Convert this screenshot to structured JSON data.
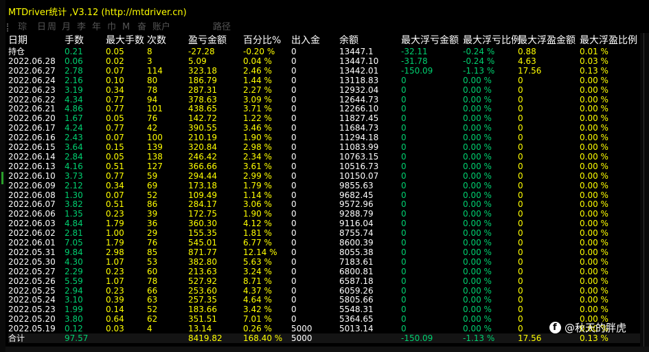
{
  "window": {
    "title": "MTDriver统计 ,V3.12 (http://mtdriver.cn)"
  },
  "toolbar": [
    "琮",
    "日",
    "周",
    "月",
    "李",
    "年",
    "巾",
    "M",
    "奋",
    "账户",
    "路径"
  ],
  "table": {
    "headers": [
      "日期",
      "手数",
      "最大手数",
      "次数",
      "盈亏金额",
      "百分比%",
      "出入金",
      "余额",
      "最大浮亏金额",
      "最大浮亏比例",
      "最大浮盈金额",
      "最大浮盈比例"
    ],
    "holdings": {
      "date": "持仓",
      "lots": "0.21",
      "max_lots": "0.05",
      "count": "8",
      "pnl": "-27.28",
      "pct": "-0.20 %",
      "io": "0",
      "balance": "13447.1",
      "max_float_loss": "-32.11",
      "max_float_loss_pct": "-0.24 %",
      "max_float_profit": "0.88",
      "max_float_profit_pct": "0.01 %"
    },
    "rows": [
      {
        "date": "2022.06.28",
        "lots": "0.06",
        "max_lots": "0.02",
        "count": "3",
        "pnl": "5.09",
        "pct": "0.04 %",
        "io": "0",
        "balance": "13447.10",
        "max_float_loss": "-31.78",
        "max_float_loss_pct": "-0.24 %",
        "max_float_profit": "4.63",
        "max_float_profit_pct": "0.03 %"
      },
      {
        "date": "2022.06.27",
        "lots": "2.78",
        "max_lots": "0.07",
        "count": "114",
        "pnl": "323.18",
        "pct": "2.46 %",
        "io": "0",
        "balance": "13442.01",
        "max_float_loss": "-150.09",
        "max_float_loss_pct": "-1.13 %",
        "max_float_profit": "17.56",
        "max_float_profit_pct": "0.13 %"
      },
      {
        "date": "2022.06.24",
        "lots": "2.16",
        "max_lots": "0.10",
        "count": "80",
        "pnl": "186.79",
        "pct": "1.44 %",
        "io": "0",
        "balance": "13118.83",
        "max_float_loss": "0",
        "max_float_loss_pct": "0.00 %",
        "max_float_profit": "0",
        "max_float_profit_pct": "0.00 %"
      },
      {
        "date": "2022.06.23",
        "lots": "3.19",
        "max_lots": "0.34",
        "count": "78",
        "pnl": "287.31",
        "pct": "2.27 %",
        "io": "0",
        "balance": "12932.04",
        "max_float_loss": "0",
        "max_float_loss_pct": "0.00 %",
        "max_float_profit": "0",
        "max_float_profit_pct": "0.00 %"
      },
      {
        "date": "2022.06.22",
        "lots": "4.34",
        "max_lots": "0.77",
        "count": "94",
        "pnl": "378.63",
        "pct": "3.09 %",
        "io": "0",
        "balance": "12644.73",
        "max_float_loss": "0",
        "max_float_loss_pct": "0.00 %",
        "max_float_profit": "0",
        "max_float_profit_pct": "0.00 %"
      },
      {
        "date": "2022.06.21",
        "lots": "4.86",
        "max_lots": "0.77",
        "count": "101",
        "pnl": "438.65",
        "pct": "3.71 %",
        "io": "0",
        "balance": "12266.10",
        "max_float_loss": "0",
        "max_float_loss_pct": "0.00 %",
        "max_float_profit": "0",
        "max_float_profit_pct": "0.00 %"
      },
      {
        "date": "2022.06.20",
        "lots": "1.67",
        "max_lots": "0.05",
        "count": "76",
        "pnl": "142.72",
        "pct": "1.22 %",
        "io": "0",
        "balance": "11827.45",
        "max_float_loss": "0",
        "max_float_loss_pct": "0.00 %",
        "max_float_profit": "0",
        "max_float_profit_pct": "0.00 %"
      },
      {
        "date": "2022.06.17",
        "lots": "4.24",
        "max_lots": "0.77",
        "count": "42",
        "pnl": "390.55",
        "pct": "3.46 %",
        "io": "0",
        "balance": "11684.73",
        "max_float_loss": "0",
        "max_float_loss_pct": "0.00 %",
        "max_float_profit": "0",
        "max_float_profit_pct": "0.00 %"
      },
      {
        "date": "2022.06.16",
        "lots": "2.43",
        "max_lots": "0.07",
        "count": "100",
        "pnl": "210.19",
        "pct": "1.90 %",
        "io": "0",
        "balance": "11294.18",
        "max_float_loss": "0",
        "max_float_loss_pct": "0.00 %",
        "max_float_profit": "0",
        "max_float_profit_pct": "0.00 %"
      },
      {
        "date": "2022.06.15",
        "lots": "3.64",
        "max_lots": "0.15",
        "count": "139",
        "pnl": "320.84",
        "pct": "2.98 %",
        "io": "0",
        "balance": "11083.99",
        "max_float_loss": "0",
        "max_float_loss_pct": "0.00 %",
        "max_float_profit": "0",
        "max_float_profit_pct": "0.00 %"
      },
      {
        "date": "2022.06.14",
        "lots": "2.84",
        "max_lots": "0.05",
        "count": "138",
        "pnl": "246.42",
        "pct": "2.34 %",
        "io": "0",
        "balance": "10763.15",
        "max_float_loss": "0",
        "max_float_loss_pct": "0.00 %",
        "max_float_profit": "0",
        "max_float_profit_pct": "0.00 %"
      },
      {
        "date": "2022.06.13",
        "lots": "4.16",
        "max_lots": "0.51",
        "count": "127",
        "pnl": "366.66",
        "pct": "3.61 %",
        "io": "0",
        "balance": "10516.73",
        "max_float_loss": "0",
        "max_float_loss_pct": "0.00 %",
        "max_float_profit": "0",
        "max_float_profit_pct": "0.00 %"
      },
      {
        "date": "2022.06.10",
        "lots": "3.73",
        "max_lots": "0.77",
        "count": "59",
        "pnl": "294.44",
        "pct": "2.99 %",
        "io": "0",
        "balance": "10150.07",
        "max_float_loss": "0",
        "max_float_loss_pct": "0.00 %",
        "max_float_profit": "0",
        "max_float_profit_pct": "0.00 %"
      },
      {
        "date": "2022.06.09",
        "lots": "2.12",
        "max_lots": "0.34",
        "count": "69",
        "pnl": "173.18",
        "pct": "1.79 %",
        "io": "0",
        "balance": "9855.63",
        "max_float_loss": "0",
        "max_float_loss_pct": "0.00 %",
        "max_float_profit": "0",
        "max_float_profit_pct": "0.00 %"
      },
      {
        "date": "2022.06.08",
        "lots": "1.30",
        "max_lots": "0.07",
        "count": "52",
        "pnl": "109.49",
        "pct": "1.14 %",
        "io": "0",
        "balance": "9682.45",
        "max_float_loss": "0",
        "max_float_loss_pct": "0.00 %",
        "max_float_profit": "0",
        "max_float_profit_pct": "0.00 %"
      },
      {
        "date": "2022.06.07",
        "lots": "3.82",
        "max_lots": "0.51",
        "count": "86",
        "pnl": "284.17",
        "pct": "3.06 %",
        "io": "0",
        "balance": "9572.96",
        "max_float_loss": "0",
        "max_float_loss_pct": "0.00 %",
        "max_float_profit": "0",
        "max_float_profit_pct": "0.00 %"
      },
      {
        "date": "2022.06.06",
        "lots": "1.35",
        "max_lots": "0.23",
        "count": "39",
        "pnl": "172.75",
        "pct": "1.90 %",
        "io": "0",
        "balance": "9288.79",
        "max_float_loss": "0",
        "max_float_loss_pct": "0.00 %",
        "max_float_profit": "0",
        "max_float_profit_pct": "0.00 %"
      },
      {
        "date": "2022.06.03",
        "lots": "4.84",
        "max_lots": "1.79",
        "count": "36",
        "pnl": "360.30",
        "pct": "4.12 %",
        "io": "0",
        "balance": "9116.04",
        "max_float_loss": "0",
        "max_float_loss_pct": "0.00 %",
        "max_float_profit": "0",
        "max_float_profit_pct": "0.00 %"
      },
      {
        "date": "2022.06.02",
        "lots": "2.81",
        "max_lots": "1.00",
        "count": "29",
        "pnl": "155.35",
        "pct": "1.81 %",
        "io": "0",
        "balance": "8755.74",
        "max_float_loss": "0",
        "max_float_loss_pct": "0.00 %",
        "max_float_profit": "0",
        "max_float_profit_pct": "0.00 %"
      },
      {
        "date": "2022.06.01",
        "lots": "7.05",
        "max_lots": "1.79",
        "count": "76",
        "pnl": "545.01",
        "pct": "6.77 %",
        "io": "0",
        "balance": "8600.39",
        "max_float_loss": "0",
        "max_float_loss_pct": "0.00 %",
        "max_float_profit": "0",
        "max_float_profit_pct": "0.00 %"
      },
      {
        "date": "2022.05.31",
        "lots": "9.84",
        "max_lots": "2.98",
        "count": "85",
        "pnl": "871.77",
        "pct": "12.14 %",
        "io": "0",
        "balance": "8055.38",
        "max_float_loss": "0",
        "max_float_loss_pct": "0.00 %",
        "max_float_profit": "0",
        "max_float_profit_pct": "0.00 %"
      },
      {
        "date": "2022.05.30",
        "lots": "4.30",
        "max_lots": "1.07",
        "count": "53",
        "pnl": "382.80",
        "pct": "5.63 %",
        "io": "0",
        "balance": "7183.61",
        "max_float_loss": "0",
        "max_float_loss_pct": "0.00 %",
        "max_float_profit": "0",
        "max_float_profit_pct": "0.00 %"
      },
      {
        "date": "2022.05.27",
        "lots": "2.29",
        "max_lots": "0.23",
        "count": "60",
        "pnl": "213.63",
        "pct": "3.24 %",
        "io": "0",
        "balance": "6800.81",
        "max_float_loss": "0",
        "max_float_loss_pct": "0.00 %",
        "max_float_profit": "0",
        "max_float_profit_pct": "0.00 %"
      },
      {
        "date": "2022.05.26",
        "lots": "5.59",
        "max_lots": "1.07",
        "count": "78",
        "pnl": "527.92",
        "pct": "8.71 %",
        "io": "0",
        "balance": "6587.18",
        "max_float_loss": "0",
        "max_float_loss_pct": "0.00 %",
        "max_float_profit": "0",
        "max_float_profit_pct": "0.00 %"
      },
      {
        "date": "2022.05.25",
        "lots": "2.94",
        "max_lots": "0.23",
        "count": "66",
        "pnl": "253.60",
        "pct": "4.37 %",
        "io": "0",
        "balance": "6059.26",
        "max_float_loss": "0",
        "max_float_loss_pct": "0.00 %",
        "max_float_profit": "0",
        "max_float_profit_pct": "0.00 %"
      },
      {
        "date": "2022.05.24",
        "lots": "3.10",
        "max_lots": "0.39",
        "count": "63",
        "pnl": "257.35",
        "pct": "4.64 %",
        "io": "0",
        "balance": "5805.66",
        "max_float_loss": "0",
        "max_float_loss_pct": "0.00 %",
        "max_float_profit": "0",
        "max_float_profit_pct": "0.00 %"
      },
      {
        "date": "2022.05.23",
        "lots": "1.99",
        "max_lots": "0.14",
        "count": "52",
        "pnl": "183.66",
        "pct": "3.42 %",
        "io": "0",
        "balance": "5548.31",
        "max_float_loss": "0",
        "max_float_loss_pct": "0.00 %",
        "max_float_profit": "0",
        "max_float_profit_pct": "0.00 %"
      },
      {
        "date": "2022.05.20",
        "lots": "3.80",
        "max_lots": "0.64",
        "count": "62",
        "pnl": "351.51",
        "pct": "7.01 %",
        "io": "0",
        "balance": "5364.65",
        "max_float_loss": "0",
        "max_float_loss_pct": "0.00 %",
        "max_float_profit": "0",
        "max_float_profit_pct": "0.00 %"
      },
      {
        "date": "2022.05.19",
        "lots": "0.12",
        "max_lots": "0.03",
        "count": "4",
        "pnl": "13.14",
        "pct": "0.26 %",
        "io": "5000",
        "balance": "5013.14",
        "max_float_loss": "0",
        "max_float_loss_pct": "0.00 %",
        "max_float_profit": "0",
        "max_float_profit_pct": "0.00 %"
      }
    ],
    "totals": {
      "date": "合计",
      "lots": "97.57",
      "max_lots": "",
      "count": "",
      "pnl": "8419.82",
      "pct": "168.40 %",
      "io": "5000",
      "balance": "",
      "max_float_loss": "-150.09",
      "max_float_loss_pct": "-1.13 %",
      "max_float_profit": "17.56",
      "max_float_profit_pct": "0.13 %"
    }
  },
  "watermark": {
    "text": "@秋天的胖虎",
    "icon": "social-logo-icon"
  },
  "colors": {
    "background": "#000000",
    "title": "#ffff00",
    "positive": "#ffff00",
    "lots": "#00d070",
    "text": "#ffffff",
    "toolbar_muted": "#555555"
  }
}
